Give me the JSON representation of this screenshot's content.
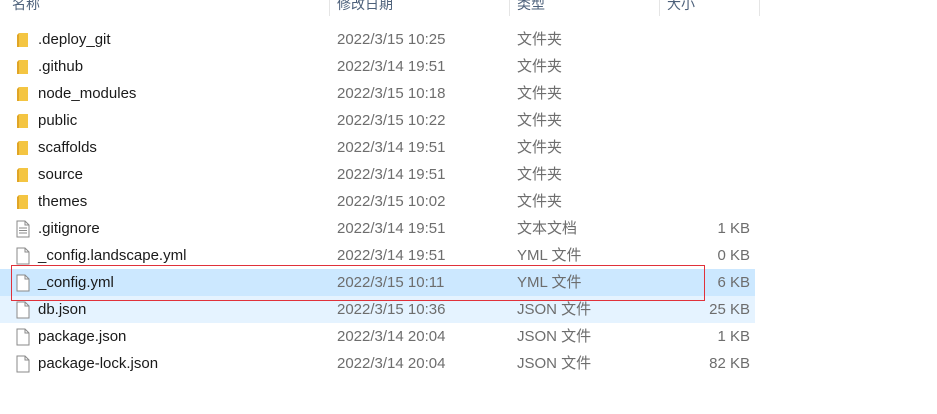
{
  "columns": {
    "name": "名称",
    "date": "修改日期",
    "type": "类型",
    "size": "大小"
  },
  "files": [
    {
      "name": ".deploy_git",
      "date": "2022/3/15 10:25",
      "type": "文件夹",
      "size": "",
      "icon": "folder-icon"
    },
    {
      "name": ".github",
      "date": "2022/3/14 19:51",
      "type": "文件夹",
      "size": "",
      "icon": "folder-icon"
    },
    {
      "name": "node_modules",
      "date": "2022/3/15 10:18",
      "type": "文件夹",
      "size": "",
      "icon": "folder-icon"
    },
    {
      "name": "public",
      "date": "2022/3/15 10:22",
      "type": "文件夹",
      "size": "",
      "icon": "folder-icon"
    },
    {
      "name": "scaffolds",
      "date": "2022/3/14 19:51",
      "type": "文件夹",
      "size": "",
      "icon": "folder-icon"
    },
    {
      "name": "source",
      "date": "2022/3/14 19:51",
      "type": "文件夹",
      "size": "",
      "icon": "folder-icon"
    },
    {
      "name": "themes",
      "date": "2022/3/15 10:02",
      "type": "文件夹",
      "size": "",
      "icon": "folder-icon"
    },
    {
      "name": ".gitignore",
      "date": "2022/3/14 19:51",
      "type": "文本文档",
      "size": "1 KB",
      "icon": "text-document-icon"
    },
    {
      "name": "_config.landscape.yml",
      "date": "2022/3/14 19:51",
      "type": "YML 文件",
      "size": "0 KB",
      "icon": "file-icon"
    },
    {
      "name": "_config.yml",
      "date": "2022/3/15 10:11",
      "type": "YML 文件",
      "size": "6 KB",
      "icon": "file-icon",
      "state": "selected"
    },
    {
      "name": "db.json",
      "date": "2022/3/15 10:36",
      "type": "JSON 文件",
      "size": "25 KB",
      "icon": "file-icon",
      "state": "hover"
    },
    {
      "name": "package.json",
      "date": "2022/3/14 20:04",
      "type": "JSON 文件",
      "size": "1 KB",
      "icon": "file-icon"
    },
    {
      "name": "package-lock.json",
      "date": "2022/3/14 20:04",
      "type": "JSON 文件",
      "size": "82 KB",
      "icon": "file-icon"
    }
  ],
  "colors": {
    "folder": "#f4c542",
    "selected_bg": "#cce8ff",
    "hover_bg": "#e5f3ff",
    "highlight_border": "#e0313a"
  }
}
